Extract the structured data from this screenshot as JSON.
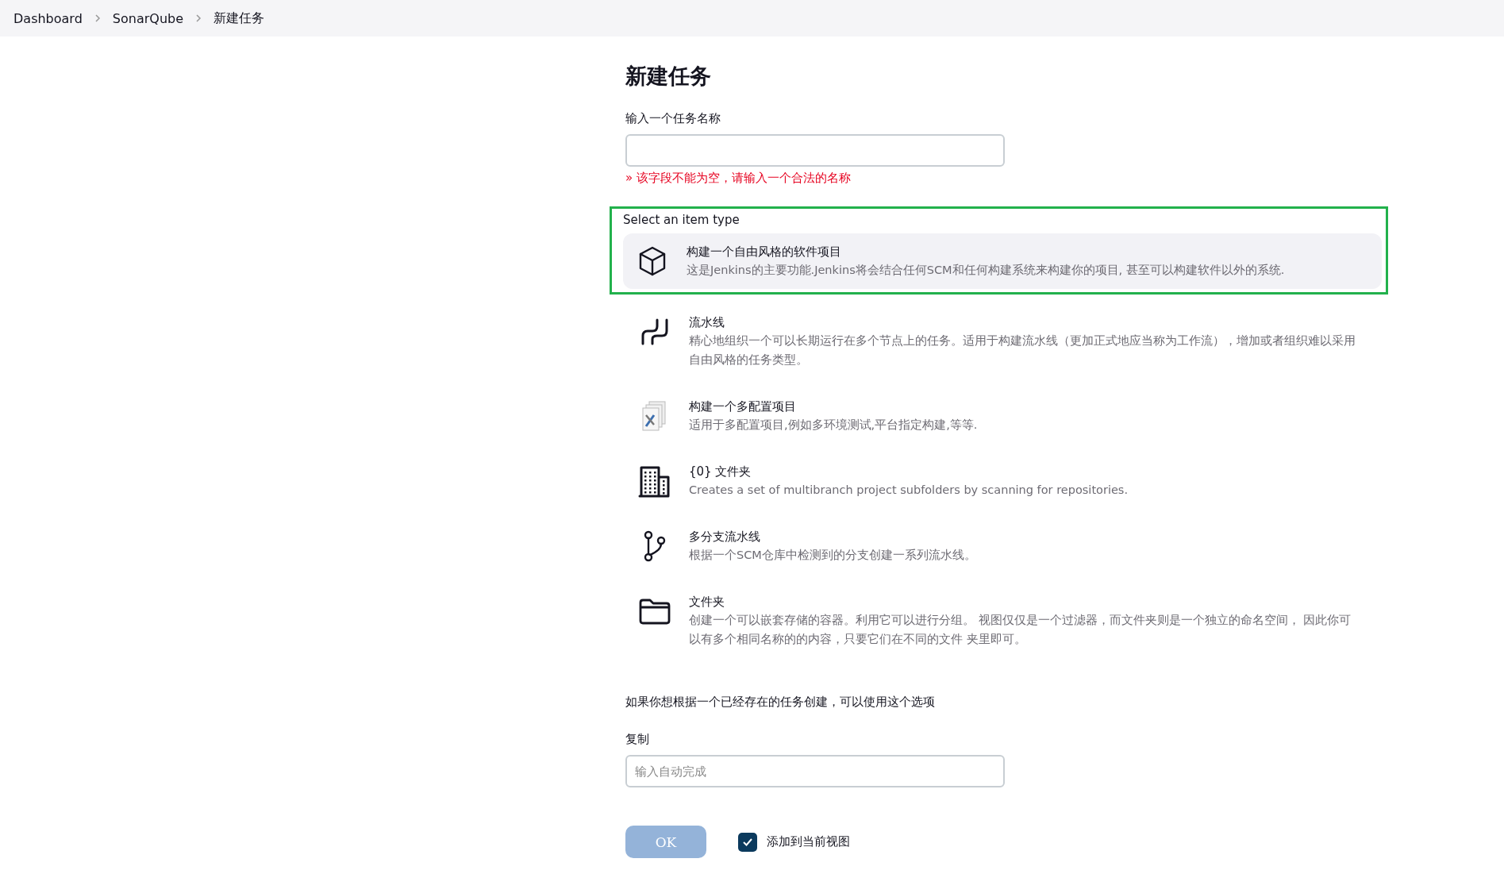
{
  "breadcrumb": [
    "Dashboard",
    "SonarQube",
    "新建任务"
  ],
  "title": "新建任务",
  "name_field": {
    "label": "输入一个任务名称",
    "error": "» 该字段不能为空，请输入一个合法的名称"
  },
  "item_type": {
    "label": "Select an item type",
    "items": [
      {
        "kind": "package",
        "title": "构建一个自由风格的软件项目",
        "description": "这是Jenkins的主要功能.Jenkins将会结合任何SCM和任何构建系统来构建你的项目, 甚至可以构建软件以外的系统.",
        "selected": true
      },
      {
        "kind": "pipeline",
        "title": "流水线",
        "description": "精心地组织一个可以长期运行在多个节点上的任务。适用于构建流水线（更加正式地应当称为工作流），增加或者组织难以采用自由风格的任务类型。",
        "selected": false
      },
      {
        "kind": "multiconfig",
        "title": "构建一个多配置项目",
        "description": "适用于多配置项目,例如多环境测试,平台指定构建,等等.",
        "selected": false
      },
      {
        "kind": "building",
        "title": "{0} 文件夹",
        "description": "Creates a set of multibranch project subfolders by scanning for repositories.",
        "selected": false
      },
      {
        "kind": "branch",
        "title": "多分支流水线",
        "description": "根据一个SCM仓库中检测到的分支创建一系列流水线。",
        "selected": false
      },
      {
        "kind": "folder",
        "title": "文件夹",
        "description": "创建一个可以嵌套存储的容器。利用它可以进行分组。 视图仅仅是一个过滤器，而文件夹则是一个独立的命名空间， 因此你可以有多个相同名称的的内容，只要它们在不同的文件 夹里即可。",
        "selected": false
      }
    ]
  },
  "copy": {
    "hint": "如果你想根据一个已经存在的任务创建，可以使用这个选项",
    "label": "复制",
    "placeholder": "输入自动完成"
  },
  "ok_button": {
    "label": "OK",
    "disabled": true
  },
  "add_to_view": {
    "label": "添加到当前视图",
    "checked": true
  }
}
